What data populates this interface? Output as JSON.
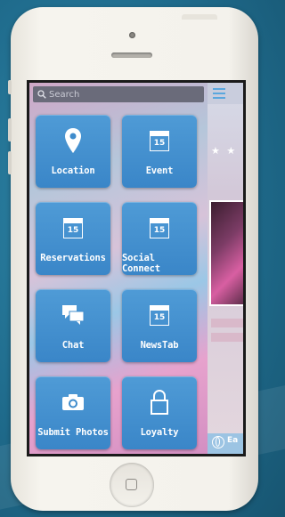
{
  "search": {
    "placeholder": "Search"
  },
  "tiles": [
    {
      "label": "Location",
      "icon": "location-pin-icon"
    },
    {
      "label": "Event",
      "icon": "calendar-icon",
      "day": "15"
    },
    {
      "label": "Reservations",
      "icon": "calendar-icon",
      "day": "15"
    },
    {
      "label": "Social Connect",
      "icon": "calendar-icon",
      "day": "15"
    },
    {
      "label": "Chat",
      "icon": "chat-bubbles-icon"
    },
    {
      "label": "NewsTab",
      "icon": "calendar-icon",
      "day": "15"
    },
    {
      "label": "Submit Photos",
      "icon": "camera-icon"
    },
    {
      "label": "Loyalty",
      "icon": "lock-icon"
    }
  ],
  "background_strip": {
    "footer_text": "Ea"
  },
  "colors": {
    "tile": "#4a96d3",
    "background": "#2479a0",
    "phone": "#f4f2ec"
  }
}
